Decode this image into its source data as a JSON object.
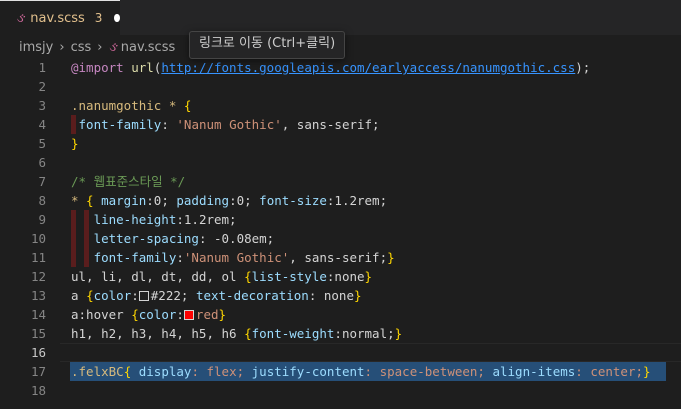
{
  "tab": {
    "filename": "nav.scss",
    "problem_count": "3",
    "icon": "sass-icon"
  },
  "breadcrumb": [
    "imsjy",
    "css",
    "nav.scss"
  ],
  "tooltip": {
    "text": "링크로 이동 (Ctrl+클릭)"
  },
  "colors": {
    "swatch_222": "#222222",
    "swatch_red": "#ff0000",
    "selection": "#264f78"
  },
  "editor": {
    "active_line": 16,
    "line_numbers": [
      "1",
      "2",
      "3",
      "4",
      "5",
      "6",
      "7",
      "8",
      "9",
      "10",
      "11",
      "12",
      "13",
      "14",
      "15",
      "16",
      "17",
      "18"
    ],
    "lines": {
      "l1": {
        "kw": "@import",
        "fn": "url",
        "open": "(",
        "url": "http://fonts.googleapis.com/earlyaccess/nanumgothic.css",
        "close": ");"
      },
      "l3": {
        "sel": ".nanumgothic",
        "star": " * ",
        "brace": "{"
      },
      "l4": {
        "prop": "font-family",
        "colon": ": ",
        "str": "'Nanum Gothic'",
        "rest": ", sans-serif;"
      },
      "l5": {
        "brace": "}"
      },
      "l7": {
        "comment": "/* 웹표준스타일 */"
      },
      "l8": {
        "sel": "*",
        "brace": " { ",
        "p1": "margin",
        "v1": ":0; ",
        "p2": "padding",
        "v2": ":0; ",
        "p3": "font-size",
        "v3": ":1.2rem;"
      },
      "l9": {
        "prop": "line-height",
        "val": ":1.2rem;"
      },
      "l10": {
        "prop": "letter-spacing",
        "val": ": -0.08em;"
      },
      "l11": {
        "prop": "font-family",
        "colon": ":",
        "str": "'Nanum Gothic'",
        "rest": ", sans-serif;",
        "brace": "}"
      },
      "l12": {
        "sel": "ul, li, dl, dt, dd, ol ",
        "brace": "{",
        "prop": "list-style",
        "val": ":none",
        "close": "}"
      },
      "l13": {
        "sel": "a ",
        "brace": "{",
        "prop": "color",
        "colon": ":",
        "val": "#222",
        "mid": "; ",
        "prop2": "text-decoration",
        "val2": ": none",
        "close": "}"
      },
      "l14": {
        "sel": "a:hover ",
        "brace": "{",
        "prop": "color",
        "colon": ":",
        "val": "red",
        "close": "}"
      },
      "l15": {
        "sel": "h1, h2, h3, h4, h5, h6 ",
        "brace": "{",
        "prop": "font-weight",
        "val": ":normal;",
        "close": "}"
      },
      "l17": {
        "sel": ".felxBC",
        "brace": "{",
        "p1": " display",
        "v1": ": flex; ",
        "p2": "justify-content",
        "v2": ": space-between; ",
        "p3": "align-items",
        "v3": ": center;",
        "close": "}"
      }
    }
  }
}
